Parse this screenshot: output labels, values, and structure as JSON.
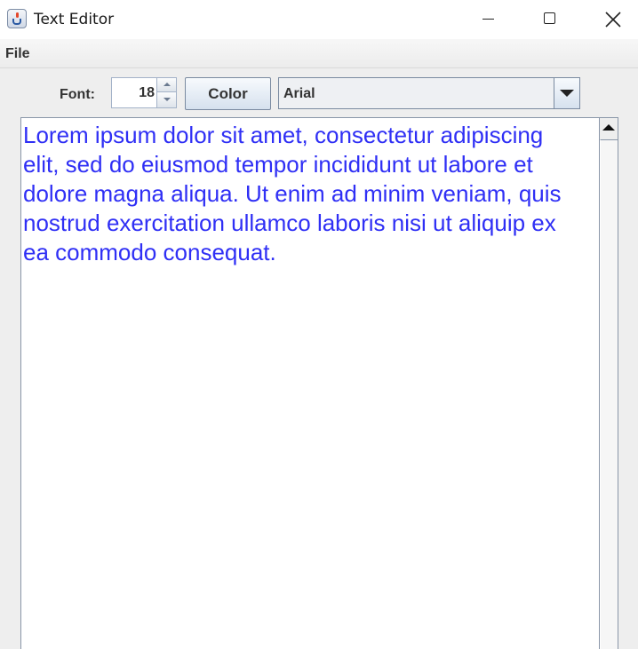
{
  "window": {
    "title": "Text Editor",
    "icon": "java-cup-icon"
  },
  "menu": {
    "file_label": "File"
  },
  "toolbar": {
    "font_label": "Font:",
    "font_size": "18",
    "color_button_label": "Color",
    "font_family_selected": "Arial"
  },
  "editor": {
    "text": "Lorem ipsum dolor sit amet, consectetur adipiscing\nelit, sed do eiusmod tempor incididunt ut labore et\ndolore magna aliqua. Ut enim ad minim veniam, quis\nnostrud exercitation ullamco laboris nisi ut aliquip ex\nea commodo consequat.",
    "text_color": "#2f2ff5"
  },
  "colors": {
    "window_bg": "#eeeeee",
    "text_color": "#2f2ff5"
  }
}
